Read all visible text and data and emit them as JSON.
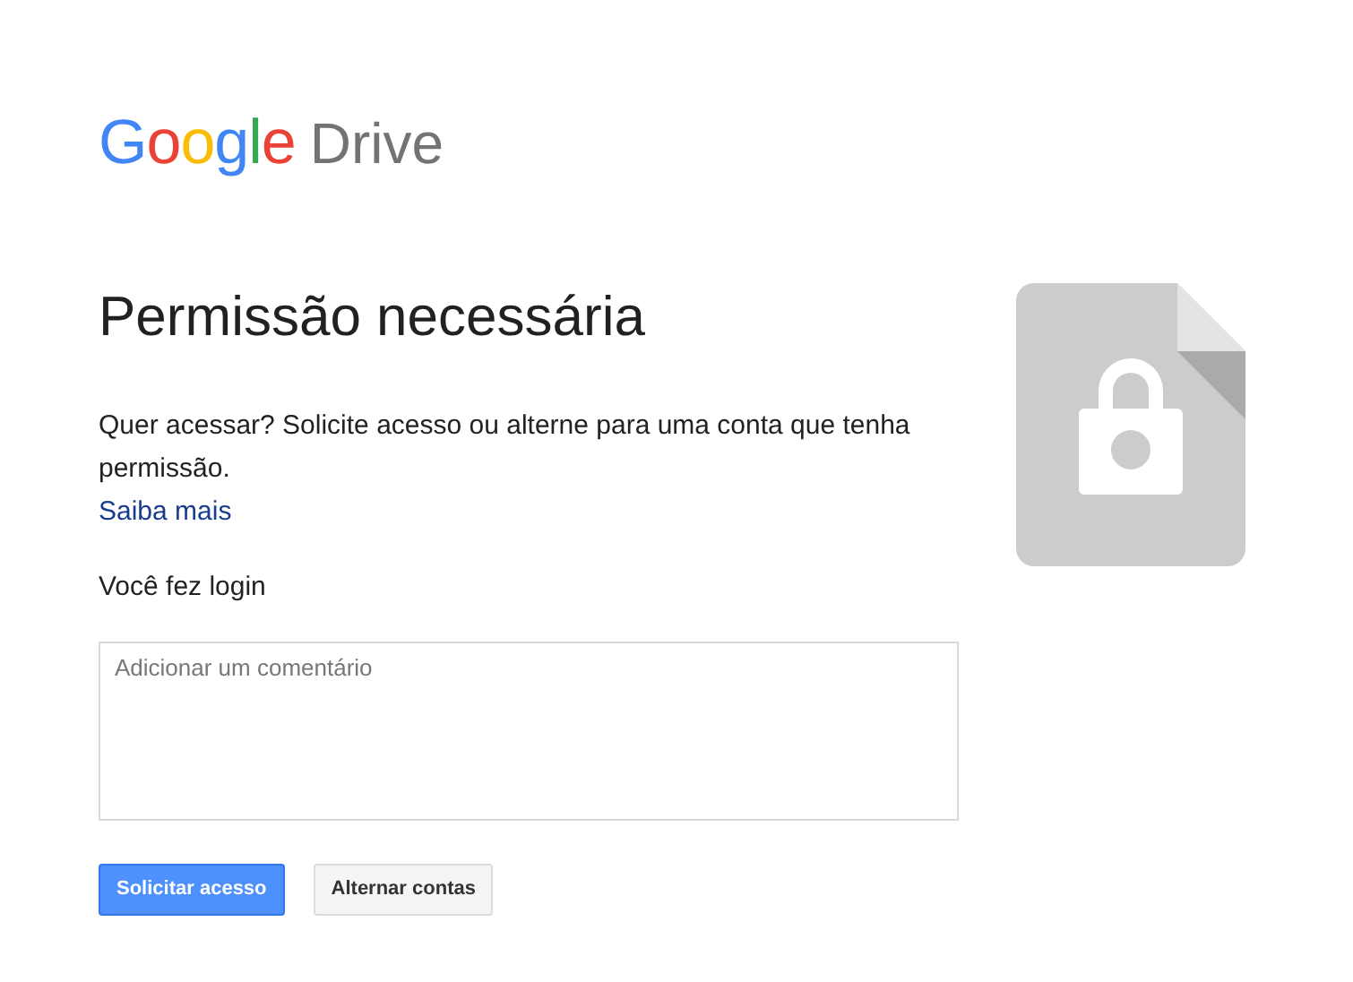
{
  "logo": {
    "brand": "Google",
    "product": "Drive"
  },
  "title": "Permissão necessária",
  "message": "Quer acessar? Solicite acesso ou alterne para uma conta que tenha permissão.",
  "learn_more_link": "Saiba mais",
  "signed_in_label": "Você fez login",
  "comment_field": {
    "placeholder": "Adicionar um comentário"
  },
  "buttons": [
    {
      "label": "Solicitar acesso",
      "kind": "primary"
    },
    {
      "label": "Alternar contas",
      "kind": "secondary"
    }
  ]
}
